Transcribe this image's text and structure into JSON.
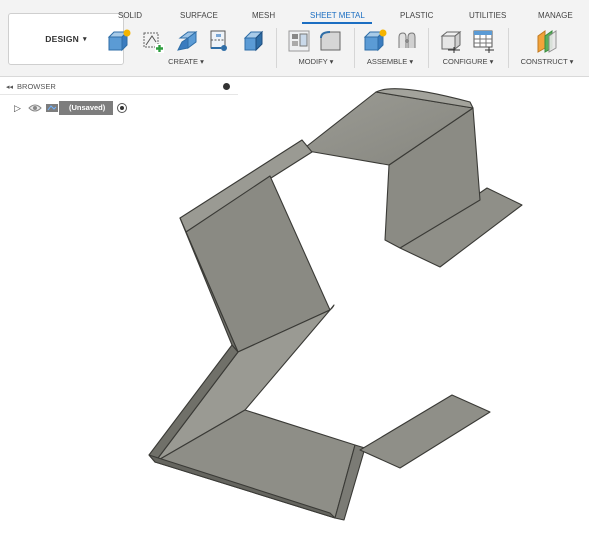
{
  "ribbon": {
    "workspace_label": "DESIGN",
    "tabs": [
      {
        "label": "SOLID",
        "active": false
      },
      {
        "label": "SURFACE",
        "active": false
      },
      {
        "label": "MESH",
        "active": false
      },
      {
        "label": "SHEET METAL",
        "active": true
      },
      {
        "label": "PLASTIC",
        "active": false
      },
      {
        "label": "UTILITIES",
        "active": false
      },
      {
        "label": "MANAGE",
        "active": false
      }
    ],
    "groups": {
      "create": "CREATE ▾",
      "modify": "MODIFY ▾",
      "assemble": "ASSEMBLE ▾",
      "configure": "CONFIGURE ▾",
      "construct": "CONSTRUCT ▾"
    },
    "accent_color": "#1b6ec2"
  },
  "browser": {
    "title": "BROWSER",
    "collapse_glyph": "◂◂",
    "root_node": {
      "expand_glyph": "▷",
      "label": "(Unsaved)"
    }
  },
  "viewport": {
    "part_color": "#8e8e87",
    "edge_color": "#3a3a36"
  }
}
